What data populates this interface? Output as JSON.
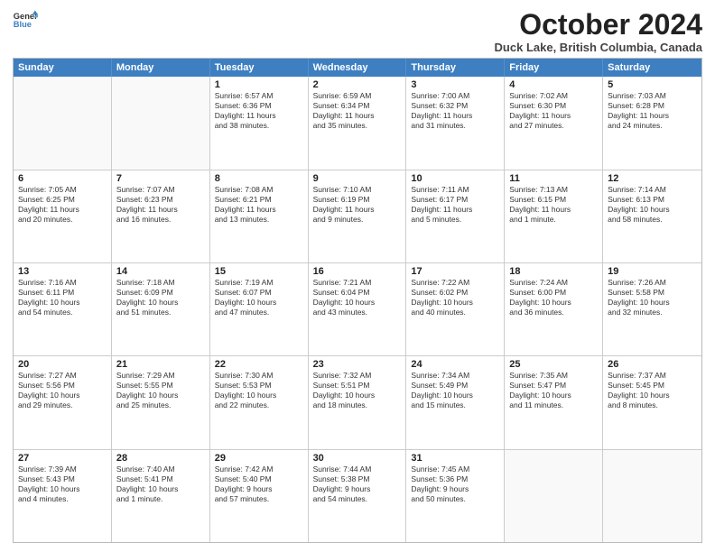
{
  "logo": {
    "line1": "General",
    "line2": "Blue"
  },
  "title": "October 2024",
  "subtitle": "Duck Lake, British Columbia, Canada",
  "header_days": [
    "Sunday",
    "Monday",
    "Tuesday",
    "Wednesday",
    "Thursday",
    "Friday",
    "Saturday"
  ],
  "rows": [
    [
      {
        "num": "",
        "text": "",
        "empty": true
      },
      {
        "num": "",
        "text": "",
        "empty": true
      },
      {
        "num": "1",
        "text": "Sunrise: 6:57 AM\nSunset: 6:36 PM\nDaylight: 11 hours\nand 38 minutes."
      },
      {
        "num": "2",
        "text": "Sunrise: 6:59 AM\nSunset: 6:34 PM\nDaylight: 11 hours\nand 35 minutes."
      },
      {
        "num": "3",
        "text": "Sunrise: 7:00 AM\nSunset: 6:32 PM\nDaylight: 11 hours\nand 31 minutes."
      },
      {
        "num": "4",
        "text": "Sunrise: 7:02 AM\nSunset: 6:30 PM\nDaylight: 11 hours\nand 27 minutes."
      },
      {
        "num": "5",
        "text": "Sunrise: 7:03 AM\nSunset: 6:28 PM\nDaylight: 11 hours\nand 24 minutes."
      }
    ],
    [
      {
        "num": "6",
        "text": "Sunrise: 7:05 AM\nSunset: 6:25 PM\nDaylight: 11 hours\nand 20 minutes."
      },
      {
        "num": "7",
        "text": "Sunrise: 7:07 AM\nSunset: 6:23 PM\nDaylight: 11 hours\nand 16 minutes."
      },
      {
        "num": "8",
        "text": "Sunrise: 7:08 AM\nSunset: 6:21 PM\nDaylight: 11 hours\nand 13 minutes."
      },
      {
        "num": "9",
        "text": "Sunrise: 7:10 AM\nSunset: 6:19 PM\nDaylight: 11 hours\nand 9 minutes."
      },
      {
        "num": "10",
        "text": "Sunrise: 7:11 AM\nSunset: 6:17 PM\nDaylight: 11 hours\nand 5 minutes."
      },
      {
        "num": "11",
        "text": "Sunrise: 7:13 AM\nSunset: 6:15 PM\nDaylight: 11 hours\nand 1 minute."
      },
      {
        "num": "12",
        "text": "Sunrise: 7:14 AM\nSunset: 6:13 PM\nDaylight: 10 hours\nand 58 minutes."
      }
    ],
    [
      {
        "num": "13",
        "text": "Sunrise: 7:16 AM\nSunset: 6:11 PM\nDaylight: 10 hours\nand 54 minutes."
      },
      {
        "num": "14",
        "text": "Sunrise: 7:18 AM\nSunset: 6:09 PM\nDaylight: 10 hours\nand 51 minutes."
      },
      {
        "num": "15",
        "text": "Sunrise: 7:19 AM\nSunset: 6:07 PM\nDaylight: 10 hours\nand 47 minutes."
      },
      {
        "num": "16",
        "text": "Sunrise: 7:21 AM\nSunset: 6:04 PM\nDaylight: 10 hours\nand 43 minutes."
      },
      {
        "num": "17",
        "text": "Sunrise: 7:22 AM\nSunset: 6:02 PM\nDaylight: 10 hours\nand 40 minutes."
      },
      {
        "num": "18",
        "text": "Sunrise: 7:24 AM\nSunset: 6:00 PM\nDaylight: 10 hours\nand 36 minutes."
      },
      {
        "num": "19",
        "text": "Sunrise: 7:26 AM\nSunset: 5:58 PM\nDaylight: 10 hours\nand 32 minutes."
      }
    ],
    [
      {
        "num": "20",
        "text": "Sunrise: 7:27 AM\nSunset: 5:56 PM\nDaylight: 10 hours\nand 29 minutes."
      },
      {
        "num": "21",
        "text": "Sunrise: 7:29 AM\nSunset: 5:55 PM\nDaylight: 10 hours\nand 25 minutes."
      },
      {
        "num": "22",
        "text": "Sunrise: 7:30 AM\nSunset: 5:53 PM\nDaylight: 10 hours\nand 22 minutes."
      },
      {
        "num": "23",
        "text": "Sunrise: 7:32 AM\nSunset: 5:51 PM\nDaylight: 10 hours\nand 18 minutes."
      },
      {
        "num": "24",
        "text": "Sunrise: 7:34 AM\nSunset: 5:49 PM\nDaylight: 10 hours\nand 15 minutes."
      },
      {
        "num": "25",
        "text": "Sunrise: 7:35 AM\nSunset: 5:47 PM\nDaylight: 10 hours\nand 11 minutes."
      },
      {
        "num": "26",
        "text": "Sunrise: 7:37 AM\nSunset: 5:45 PM\nDaylight: 10 hours\nand 8 minutes."
      }
    ],
    [
      {
        "num": "27",
        "text": "Sunrise: 7:39 AM\nSunset: 5:43 PM\nDaylight: 10 hours\nand 4 minutes."
      },
      {
        "num": "28",
        "text": "Sunrise: 7:40 AM\nSunset: 5:41 PM\nDaylight: 10 hours\nand 1 minute."
      },
      {
        "num": "29",
        "text": "Sunrise: 7:42 AM\nSunset: 5:40 PM\nDaylight: 9 hours\nand 57 minutes."
      },
      {
        "num": "30",
        "text": "Sunrise: 7:44 AM\nSunset: 5:38 PM\nDaylight: 9 hours\nand 54 minutes."
      },
      {
        "num": "31",
        "text": "Sunrise: 7:45 AM\nSunset: 5:36 PM\nDaylight: 9 hours\nand 50 minutes."
      },
      {
        "num": "",
        "text": "",
        "empty": true
      },
      {
        "num": "",
        "text": "",
        "empty": true
      }
    ]
  ]
}
